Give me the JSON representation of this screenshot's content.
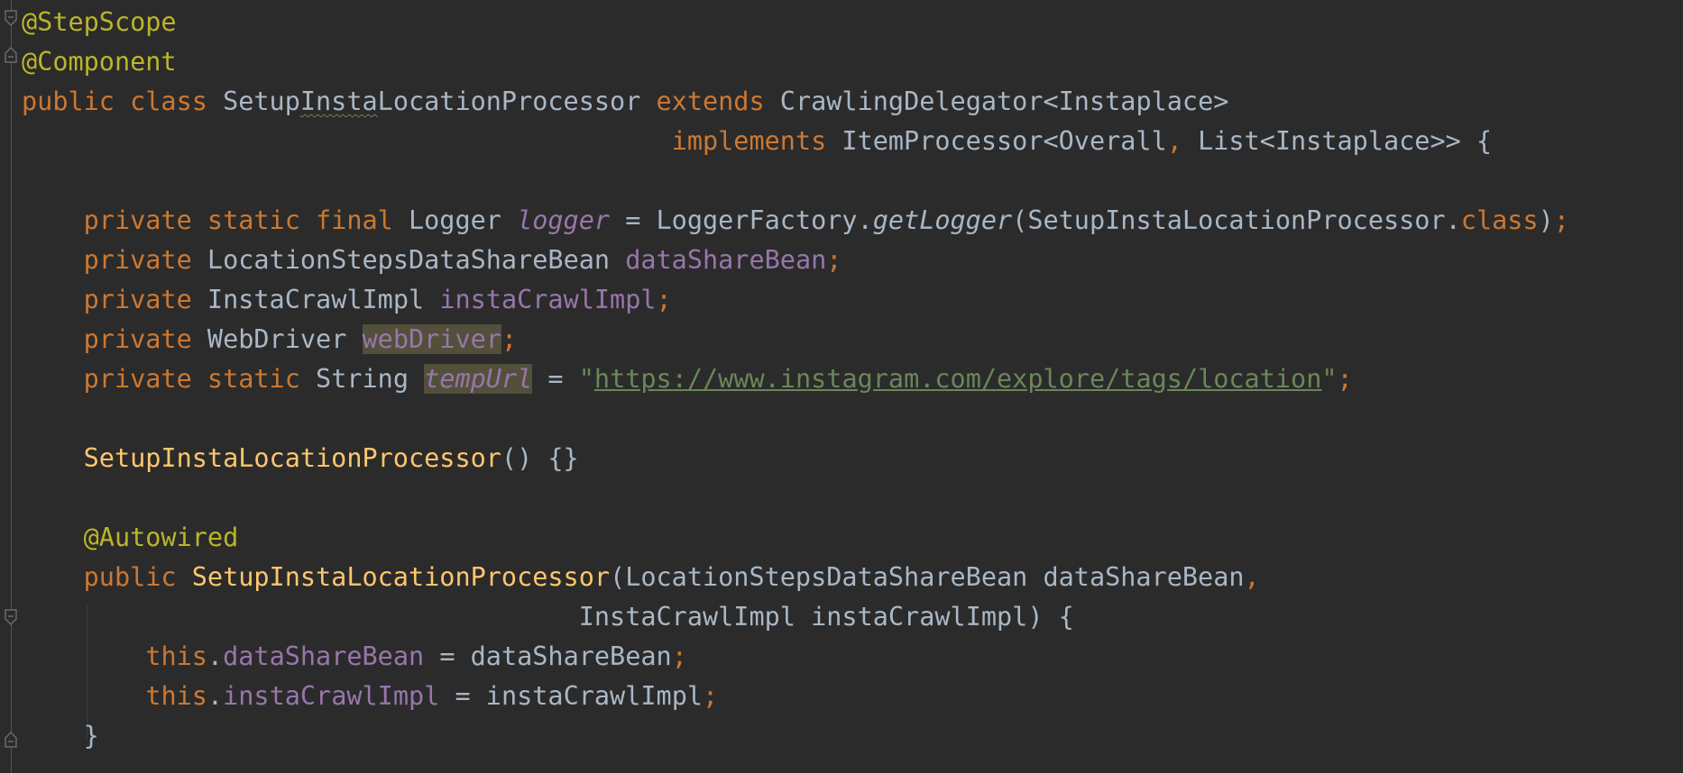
{
  "editor": {
    "lines": [
      {
        "segments": [
          {
            "t": "@StepScope",
            "c": "ann"
          }
        ]
      },
      {
        "segments": [
          {
            "t": "@Component",
            "c": "ann"
          }
        ]
      },
      {
        "segments": [
          {
            "t": "public class ",
            "c": "kw"
          },
          {
            "t": "Setup",
            "c": ""
          },
          {
            "t": "Insta",
            "c": "typo"
          },
          {
            "t": "LocationProcessor ",
            "c": ""
          },
          {
            "t": "extends ",
            "c": "kw"
          },
          {
            "t": "CrawlingDelegator<Instaplace>",
            "c": ""
          }
        ]
      },
      {
        "segments": [
          {
            "t": "                                          ",
            "c": ""
          },
          {
            "t": "implements ",
            "c": "kw"
          },
          {
            "t": "ItemProcessor<Overall",
            "c": ""
          },
          {
            "t": ", ",
            "c": "punct"
          },
          {
            "t": "List<Instaplace>> {",
            "c": ""
          }
        ]
      },
      {
        "segments": []
      },
      {
        "segments": [
          {
            "t": "    ",
            "c": ""
          },
          {
            "t": "private static final ",
            "c": "kw"
          },
          {
            "t": "Logger ",
            "c": ""
          },
          {
            "t": "logger",
            "c": "sfield"
          },
          {
            "t": " = LoggerFactory.",
            "c": ""
          },
          {
            "t": "getLogger",
            "c": "smeth"
          },
          {
            "t": "(SetupInstaLocationProcessor.",
            "c": ""
          },
          {
            "t": "class",
            "c": "kw"
          },
          {
            "t": ")",
            "c": ""
          },
          {
            "t": ";",
            "c": "punct"
          }
        ]
      },
      {
        "segments": [
          {
            "t": "    ",
            "c": ""
          },
          {
            "t": "private ",
            "c": "kw"
          },
          {
            "t": "LocationStepsDataShareBean ",
            "c": ""
          },
          {
            "t": "dataShareBean",
            "c": "field"
          },
          {
            "t": ";",
            "c": "punct"
          }
        ]
      },
      {
        "segments": [
          {
            "t": "    ",
            "c": ""
          },
          {
            "t": "private ",
            "c": "kw"
          },
          {
            "t": "InstaCrawlImpl ",
            "c": ""
          },
          {
            "t": "instaCrawlImpl",
            "c": "field"
          },
          {
            "t": ";",
            "c": "punct"
          }
        ]
      },
      {
        "segments": [
          {
            "t": "    ",
            "c": ""
          },
          {
            "t": "private ",
            "c": "kw"
          },
          {
            "t": "WebDriver ",
            "c": ""
          },
          {
            "t": "webDriver",
            "c": "field hl"
          },
          {
            "t": ";",
            "c": "punct"
          }
        ]
      },
      {
        "segments": [
          {
            "t": "    ",
            "c": ""
          },
          {
            "t": "private static ",
            "c": "kw"
          },
          {
            "t": "String ",
            "c": ""
          },
          {
            "t": "tempUrl",
            "c": "sfield hl"
          },
          {
            "t": " = ",
            "c": ""
          },
          {
            "t": "\"",
            "c": "str"
          },
          {
            "t": "https://www.instagram.com/explore/tags/location",
            "c": "url"
          },
          {
            "t": "\"",
            "c": "str"
          },
          {
            "t": ";",
            "c": "punct"
          }
        ]
      },
      {
        "segments": []
      },
      {
        "segments": [
          {
            "t": "    ",
            "c": ""
          },
          {
            "t": "SetupInstaLocationProcessor",
            "c": "fn"
          },
          {
            "t": "() {}",
            "c": ""
          }
        ]
      },
      {
        "segments": []
      },
      {
        "segments": [
          {
            "t": "    ",
            "c": ""
          },
          {
            "t": "@Autowired",
            "c": "ann"
          }
        ]
      },
      {
        "segments": [
          {
            "t": "    ",
            "c": ""
          },
          {
            "t": "public ",
            "c": "kw"
          },
          {
            "t": "SetupInstaLocationProcessor",
            "c": "fn"
          },
          {
            "t": "(LocationStepsDataShareBean dataShareBean",
            "c": ""
          },
          {
            "t": ",",
            "c": "punct"
          }
        ]
      },
      {
        "segments": [
          {
            "t": "                                    ",
            "c": ""
          },
          {
            "t": "InstaCrawlImpl instaCrawlImpl) {",
            "c": ""
          }
        ]
      },
      {
        "segments": [
          {
            "t": "        ",
            "c": ""
          },
          {
            "t": "this",
            "c": "kw"
          },
          {
            "t": ".",
            "c": ""
          },
          {
            "t": "dataShareBean",
            "c": "field"
          },
          {
            "t": " = dataShareBean",
            "c": ""
          },
          {
            "t": ";",
            "c": "punct"
          }
        ]
      },
      {
        "segments": [
          {
            "t": "        ",
            "c": ""
          },
          {
            "t": "this",
            "c": "kw"
          },
          {
            "t": ".",
            "c": ""
          },
          {
            "t": "instaCrawlImpl",
            "c": "field"
          },
          {
            "t": " = instaCrawlImpl",
            "c": ""
          },
          {
            "t": ";",
            "c": "punct"
          }
        ]
      },
      {
        "segments": [
          {
            "t": "    ",
            "c": ""
          },
          {
            "t": "}",
            "c": ""
          }
        ]
      }
    ]
  },
  "colors": {
    "background": "#2b2b2b",
    "keyword": "#cc7832",
    "annotation": "#bbb529",
    "method_declaration": "#ffc66d",
    "field": "#9876aa",
    "string": "#6a8759",
    "default_text": "#a9b7c6",
    "highlight": "#52503a"
  },
  "icons": {
    "fold_open": "fold-open-icon",
    "fold_close": "fold-close-icon"
  }
}
